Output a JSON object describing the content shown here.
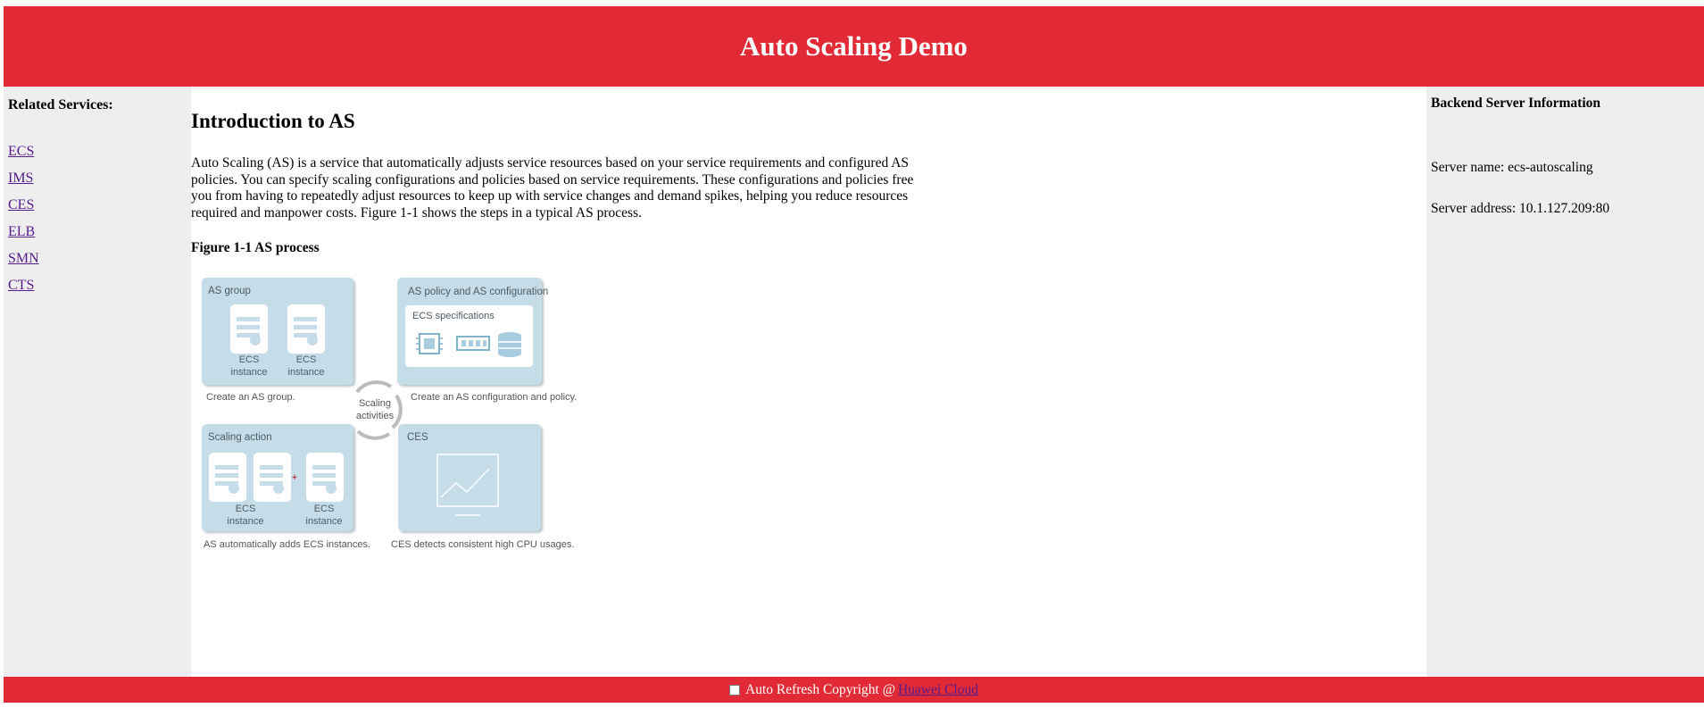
{
  "header": {
    "title": "Auto Scaling Demo"
  },
  "left_sidebar": {
    "title": "Related Services:",
    "links": [
      "ECS",
      "IMS",
      "CES",
      "ELB",
      "SMN",
      "CTS"
    ]
  },
  "main": {
    "heading": "Introduction to AS",
    "intro": "Auto Scaling (AS) is a service that automatically adjusts service resources based on your service requirements and configured AS policies. You can specify scaling configurations and policies based on service requirements. These configurations and policies free you from having to repeatedly adjust resources to keep up with service changes and demand spikes, helping you reduce resources required and manpower costs. Figure 1-1 shows the steps in a typical AS process.",
    "figure_caption": "Figure 1-1 AS process"
  },
  "diagram": {
    "as_group": {
      "title": "AS group",
      "instance_line1": "ECS",
      "instance_line2": "instance",
      "caption": "Create an AS group."
    },
    "as_policy": {
      "title": "AS policy and AS configuration",
      "spec_title": "ECS specifications",
      "caption": "Create an AS configuration and policy."
    },
    "center": {
      "line1": "Scaling",
      "line2": "activities"
    },
    "scaling_action": {
      "title": "Scaling action",
      "instance_line1": "ECS",
      "instance_line2": "instance",
      "plus": "+",
      "caption": "AS automatically adds ECS instances."
    },
    "ces": {
      "title": "CES",
      "caption": "CES detects consistent high CPU usages."
    }
  },
  "right_sidebar": {
    "title": "Backend Server Information",
    "server_name": "Server name: ecs-autoscaling",
    "server_address": "Server address: 10.1.127.209:80"
  },
  "footer": {
    "auto_refresh_label": "Auto Refresh Copyright @",
    "link_text": "Huawei Cloud"
  },
  "colors": {
    "brand_red": "#e12a36",
    "sidebar_gray": "#eeeeee",
    "panel_blue": "#c5dde8",
    "link_purple": "#551a8b"
  }
}
